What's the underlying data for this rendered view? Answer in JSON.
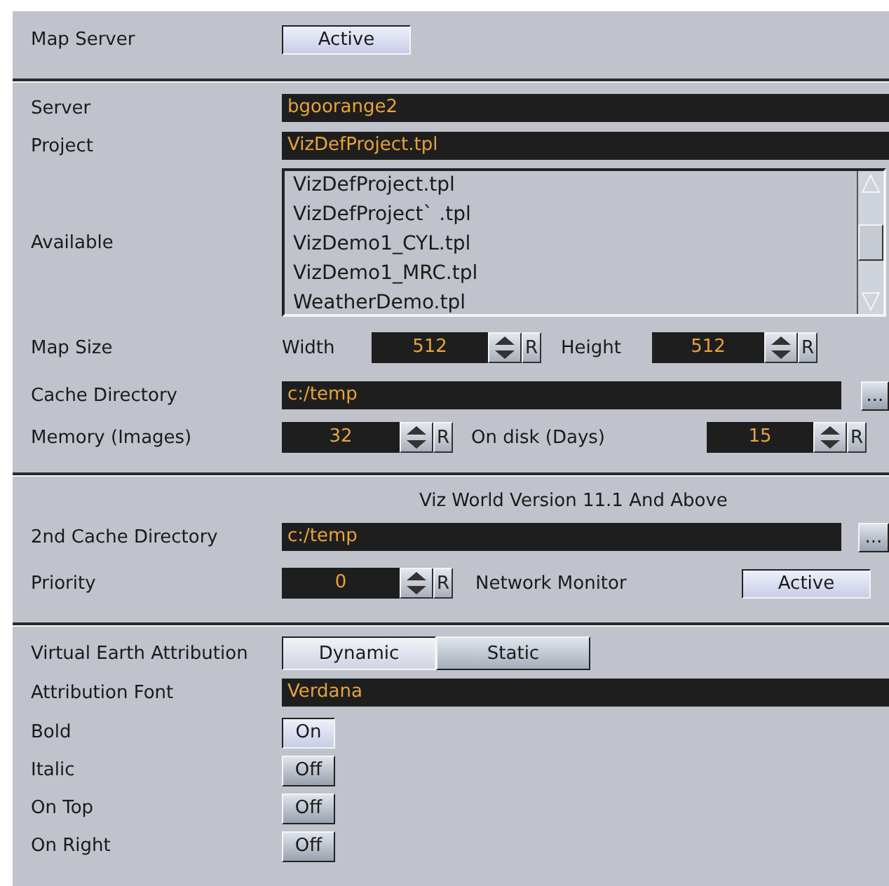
{
  "map_server": {
    "label": "Map Server",
    "button": {
      "label": "Active",
      "on": true
    }
  },
  "server": {
    "label": "Server",
    "value": "bgoorange2"
  },
  "project": {
    "label": "Project",
    "value": "VizDefProject.tpl"
  },
  "available": {
    "label": "Available",
    "items": [
      {
        "label": "VizDefProject.tpl",
        "selected": false
      },
      {
        "label": "VizDefProject` .tpl",
        "selected": false
      },
      {
        "label": "VizDemo1_CYL.tpl",
        "selected": false
      },
      {
        "label": "VizDemo1_MRC.tpl",
        "selected": false
      },
      {
        "label": "WeatherDemo.tpl",
        "selected": false
      }
    ]
  },
  "map_size": {
    "label": "Map Size",
    "width": {
      "label": "Width",
      "value": "512",
      "reset": "R"
    },
    "height": {
      "label": "Height",
      "value": "512",
      "reset": "R"
    }
  },
  "cache_directory": {
    "label": "Cache Directory",
    "value": "c:/temp",
    "browse": "..."
  },
  "memory": {
    "label": "Memory (Images)",
    "value": "32",
    "reset": "R"
  },
  "on_disk": {
    "label": "On disk (Days)",
    "value": "15",
    "reset": "R"
  },
  "version_note": "Viz World Version 11.1 And Above",
  "second_cache_directory": {
    "label": "2nd Cache Directory",
    "value": "c:/temp",
    "browse": "..."
  },
  "priority": {
    "label": "Priority",
    "value": "0",
    "reset": "R"
  },
  "network_monitor": {
    "label": "Network Monitor",
    "button": {
      "label": "Active",
      "on": true
    }
  },
  "attribution": {
    "label": "Virtual Earth Attribution",
    "options": [
      {
        "label": "Dynamic",
        "selected": true
      },
      {
        "label": "Static",
        "selected": false
      }
    ]
  },
  "attribution_font": {
    "label": "Attribution Font",
    "value": "Verdana"
  },
  "toggles": [
    {
      "label": "Bold",
      "value": "On",
      "on": true
    },
    {
      "label": "Italic",
      "value": "Off",
      "on": false
    },
    {
      "label": "On Top",
      "value": "Off",
      "on": false
    },
    {
      "label": "On Right",
      "value": "Off",
      "on": false
    }
  ]
}
